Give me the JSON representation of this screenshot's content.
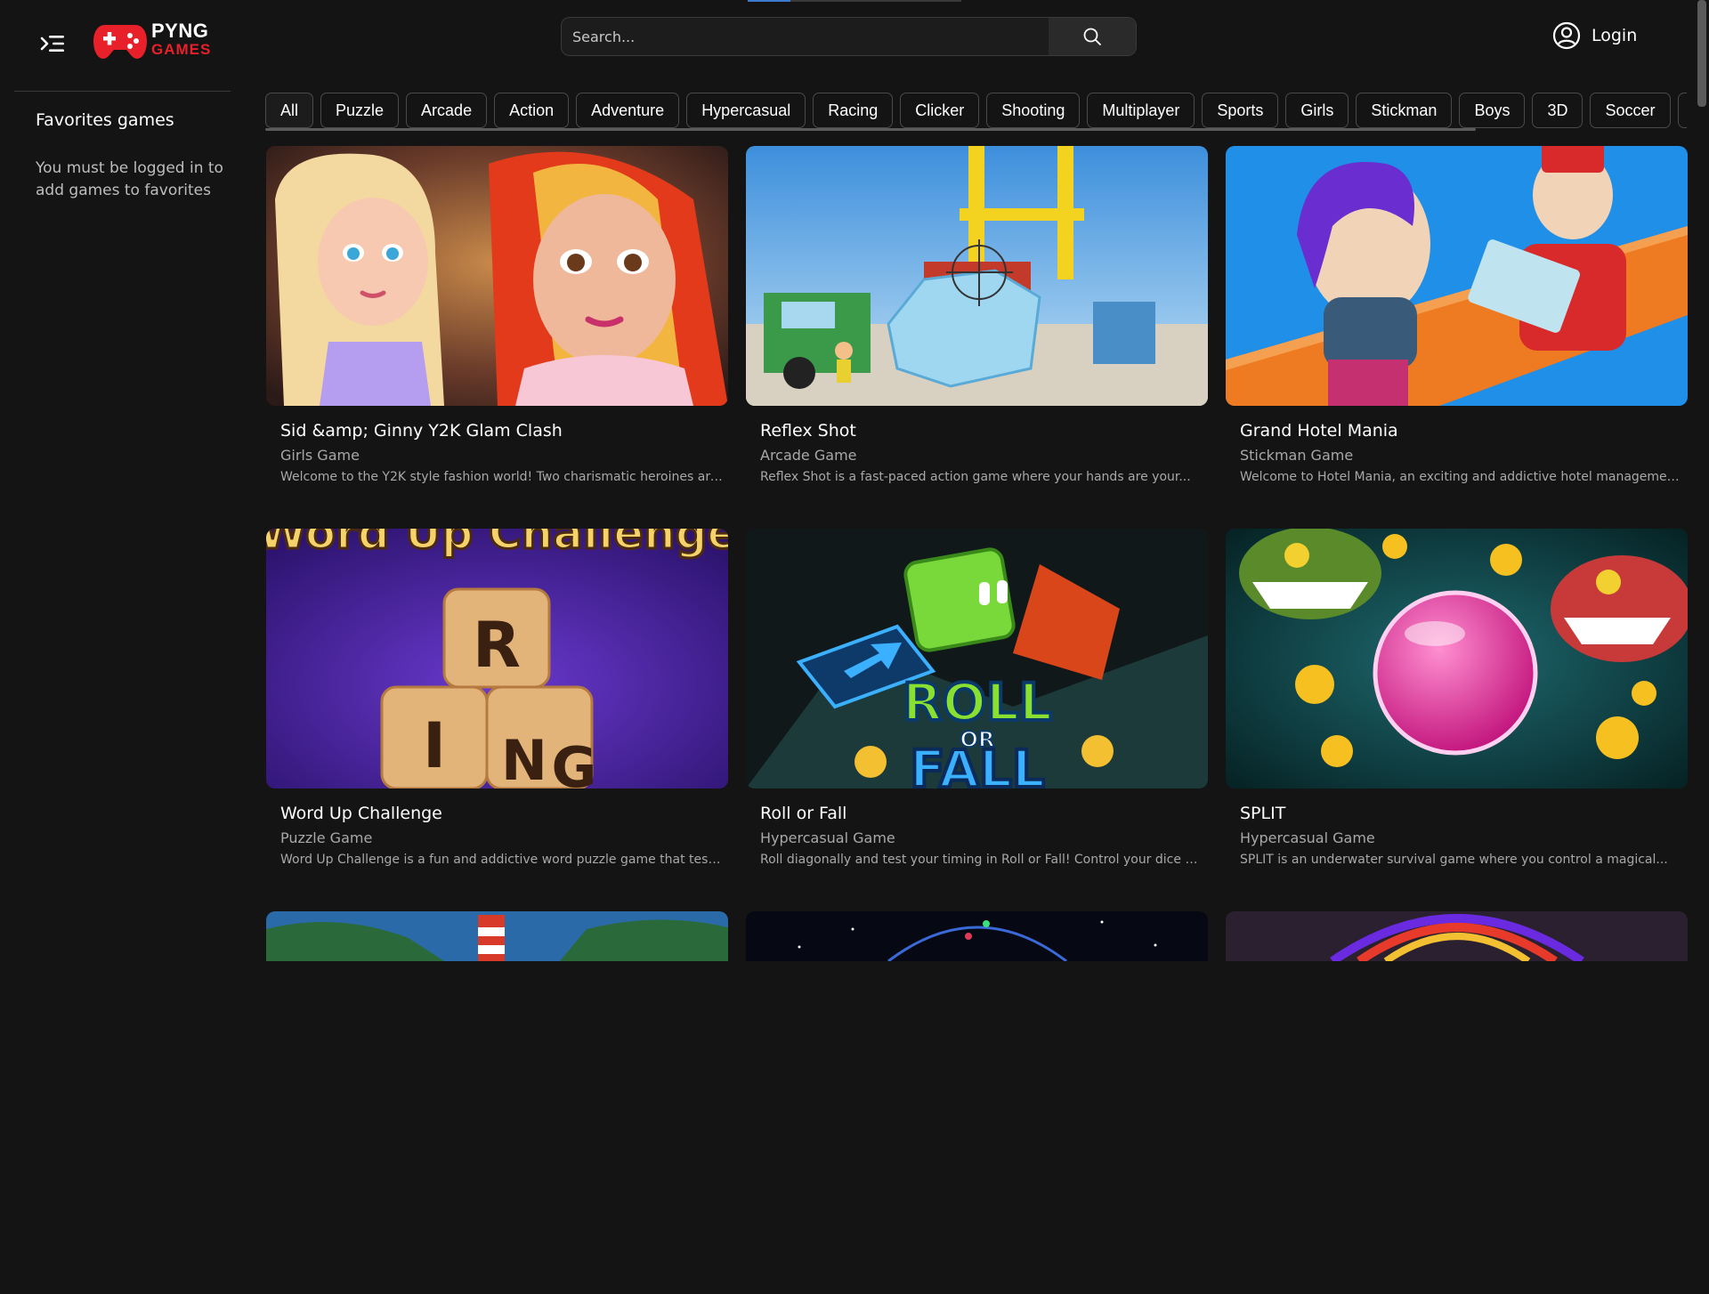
{
  "header": {
    "logo": {
      "line1": "PYNG",
      "line2": "GAMES"
    },
    "search": {
      "placeholder": "Search..."
    },
    "login_label": "Login"
  },
  "sidebar": {
    "favorites_title": "Favorites games",
    "favorites_note": "You must be logged in to add games to favorites"
  },
  "categories": [
    "All",
    "Puzzle",
    "Arcade",
    "Action",
    "Adventure",
    "Hypercasual",
    "Racing",
    "Clicker",
    "Shooting",
    "Multiplayer",
    "Sports",
    "Girls",
    "Stickman",
    "Boys",
    "3D",
    "Soccer"
  ],
  "games": [
    {
      "title": "Sid &amp; Ginny Y2K Glam Clash",
      "category": "Girls Game",
      "description": "Welcome to the Y2K style fashion world! Two charismatic heroines are..."
    },
    {
      "title": "Reflex Shot",
      "category": "Arcade Game",
      "description": "Reflex Shot is a fast-paced action game where your hands are your..."
    },
    {
      "title": "Grand Hotel Mania",
      "category": "Stickman Game",
      "description": "Welcome to Hotel Mania, an exciting and addictive hotel management..."
    },
    {
      "title": "Word Up Challenge",
      "category": "Puzzle Game",
      "description": "Word Up Challenge is a fun and addictive word puzzle game that tests..."
    },
    {
      "title": "Roll or Fall",
      "category": "Hypercasual Game",
      "description": "Roll diagonally and test your timing in Roll or Fall! Control your dice a..."
    },
    {
      "title": "SPLIT",
      "category": "Hypercasual Game",
      "description": "SPLIT is an underwater survival game where you control a magical..."
    }
  ],
  "thumb_art": {
    "word_up_banner": "Word Up Challenge",
    "word_up_tiles": [
      "R",
      "I",
      "N",
      "G"
    ],
    "roll_logo": [
      "ROLL",
      "OR",
      "FALL"
    ]
  },
  "colors": {
    "background": "#141414",
    "brand_red": "#e8202a",
    "chip_border": "#4a4a4a",
    "muted_text": "#a8a8a8"
  }
}
